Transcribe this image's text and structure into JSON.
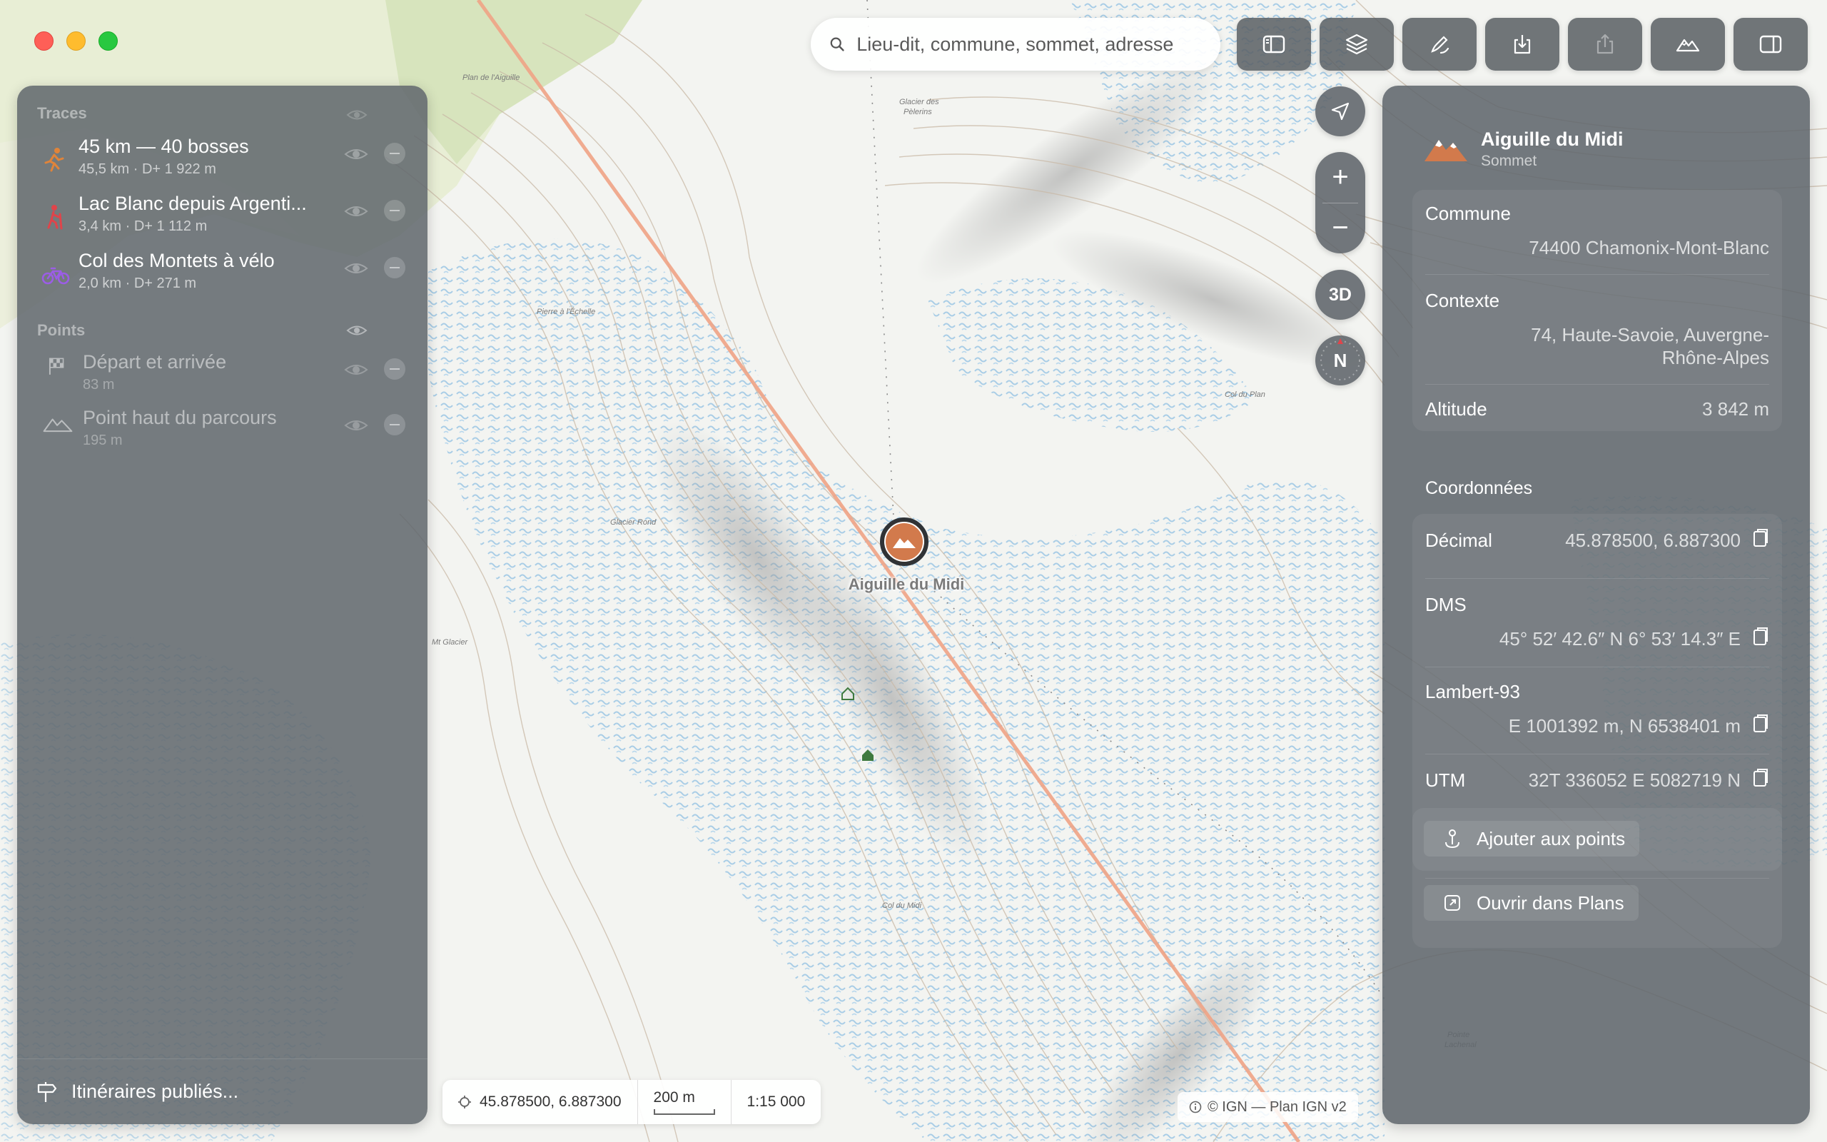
{
  "search": {
    "placeholder": "Lieu-dit, commune, sommet, adresse"
  },
  "toolbar": {
    "buttons": [
      {
        "name": "sidebar-toggle",
        "icon": "sidebar-left-icon"
      },
      {
        "name": "layers",
        "icon": "layers-icon"
      },
      {
        "name": "draw",
        "icon": "pen-icon"
      },
      {
        "name": "import",
        "icon": "download-icon"
      },
      {
        "name": "share",
        "icon": "share-icon",
        "disabled": true
      },
      {
        "name": "elevation-profile",
        "icon": "mountain-icon"
      },
      {
        "name": "inspector-toggle",
        "icon": "sidebar-right-icon"
      }
    ]
  },
  "sidebar": {
    "traces_heading": "Traces",
    "points_heading": "Points",
    "traces": [
      {
        "name": "45 km — 40 bosses",
        "distance": "45,5 km",
        "climb": "D+ 1 922 m",
        "icon": "running-icon",
        "color": "#e0843a"
      },
      {
        "name": "Lac Blanc depuis Argenti...",
        "distance": "3,4 km",
        "climb": "D+ 1 112 m",
        "icon": "hiking-icon",
        "color": "#e0444a"
      },
      {
        "name": "Col des Montets à vélo",
        "distance": "2,0 km",
        "climb": "D+ 271 m",
        "icon": "bicycle-icon",
        "color": "#9b5de5"
      }
    ],
    "points": [
      {
        "name": "Départ et arrivée",
        "elevation": "83 m",
        "icon": "checkered-flag-icon"
      },
      {
        "name": "Point haut du parcours",
        "elevation": "195 m",
        "icon": "mountain-icon"
      }
    ],
    "footer": "Itinéraires publiés..."
  },
  "map_controls": {
    "three_d": "3D",
    "compass": "N",
    "zoom_in": "+",
    "zoom_out": "−"
  },
  "marker": {
    "label": "Aiguille du Midi"
  },
  "status": {
    "coordinates": "45.878500, 6.887300",
    "scale_label": "200 m",
    "ratio": "1:15 000"
  },
  "attribution": "© IGN — Plan IGN v2",
  "inspector": {
    "title": "Aiguille du Midi",
    "subtitle": "Sommet",
    "commune_label": "Commune",
    "commune_value": "74400 Chamonix-Mont-Blanc",
    "context_label": "Contexte",
    "context_value_1": "74, Haute-Savoie, Auvergne-",
    "context_value_2": "Rhône-Alpes",
    "altitude_label": "Altitude",
    "altitude_value": "3 842 m",
    "coords_heading": "Coordonnées",
    "decimal_label": "Décimal",
    "decimal_value": "45.878500, 6.887300",
    "dms_label": "DMS",
    "dms_value": "45° 52′ 42.6″ N 6° 53′ 14.3″ E",
    "lambert_label": "Lambert-93",
    "lambert_value": "E 1001392 m, N 6538401 m",
    "utm_label": "UTM",
    "utm_value": "32T 336052 E 5082719 N",
    "add_points": "Ajouter aux points",
    "open_plans": "Ouvrir dans Plans"
  },
  "colors": {
    "accent": "#d27a4c",
    "panel": "#60666c",
    "route": "#f0a080"
  }
}
